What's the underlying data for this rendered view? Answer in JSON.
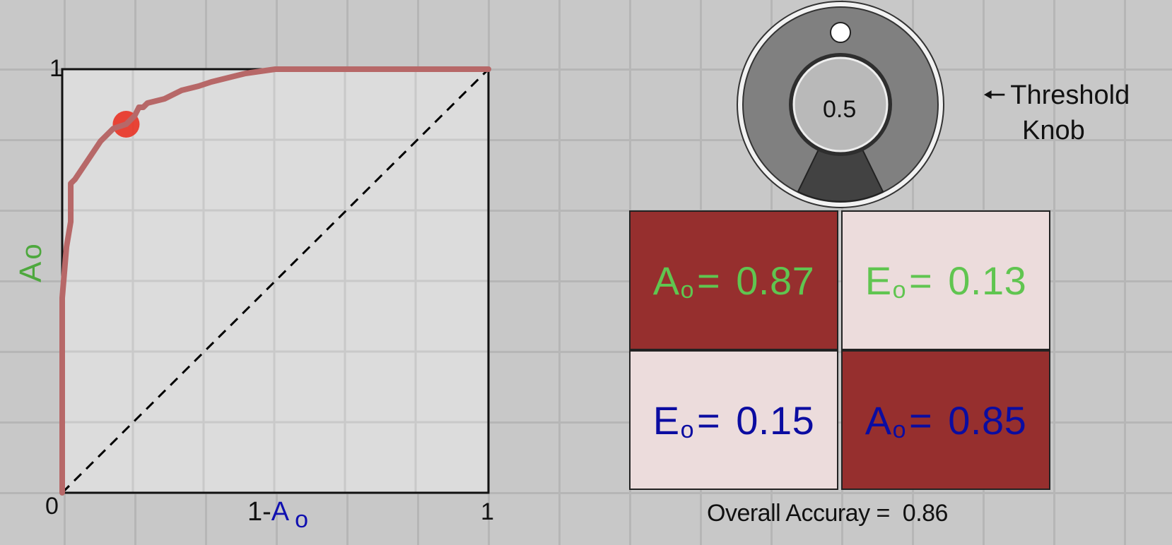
{
  "roc_chart": {
    "y_axis_symbol": "A",
    "y_axis_subscript": "o",
    "y_top_tick": "1",
    "origin_tick": "0",
    "x_right_tick": "1",
    "x_axis_prefix": "1-",
    "x_axis_symbol": "A",
    "x_axis_subscript": "o"
  },
  "chart_data": {
    "type": "line",
    "xlim": [
      0,
      1
    ],
    "ylim": [
      0,
      1
    ],
    "series": [
      {
        "x": [
          0.0,
          0.0,
          0.01,
          0.02,
          0.02,
          0.03,
          0.05,
          0.07,
          0.09,
          0.12,
          0.15,
          0.17,
          0.18,
          0.19,
          0.2,
          0.24,
          0.28,
          0.32,
          0.35,
          0.39,
          0.43,
          0.5,
          0.6,
          0.75,
          0.9,
          1.0
        ],
        "y": [
          0.0,
          0.46,
          0.58,
          0.64,
          0.73,
          0.74,
          0.77,
          0.8,
          0.83,
          0.86,
          0.87,
          0.89,
          0.91,
          0.91,
          0.92,
          0.93,
          0.95,
          0.96,
          0.97,
          0.98,
          0.99,
          1.0,
          1.0,
          1.0,
          1.0,
          1.0
        ]
      }
    ],
    "reference_line": {
      "x": [
        0,
        1
      ],
      "y": [
        0,
        1
      ]
    },
    "operating_point": {
      "x": 0.15,
      "y": 0.87
    },
    "colors": {
      "curve": "#b76868",
      "point": "#e83a2c",
      "reference": "#000000",
      "plot_background": "#dcdcdc"
    }
  },
  "knob": {
    "value": "0.5",
    "label_line1": "Threshold",
    "label_line2": "Knob"
  },
  "matrix": {
    "cells": [
      {
        "symbol": "A",
        "sub": "o",
        "eq": "=",
        "value": "0.87"
      },
      {
        "symbol": "E",
        "sub": "o",
        "eq": "=",
        "value": "0.13"
      },
      {
        "symbol": "E",
        "sub": "o",
        "eq": "=",
        "value": "0.15"
      },
      {
        "symbol": "A",
        "sub": "o",
        "eq": "=",
        "value": "0.85"
      }
    ],
    "colors": {
      "dark": "#962f2e",
      "light": "#ecdcdc",
      "green": "#60c550",
      "blue": "#0b0ca1"
    }
  },
  "overall": {
    "label": "Overall Accuray =",
    "value": "0.86"
  }
}
